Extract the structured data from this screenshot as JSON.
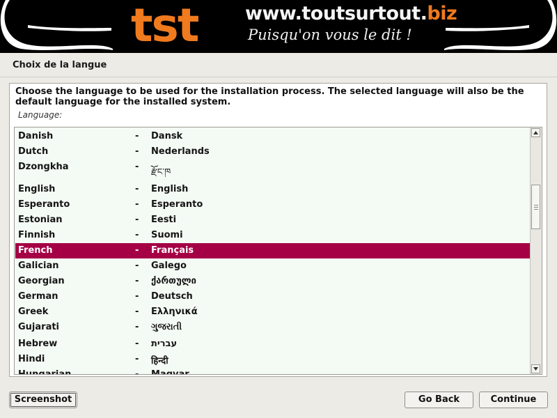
{
  "banner": {
    "logo_text": "tst",
    "site_main": "www.toutsurtout.",
    "site_tld": "biz",
    "slogan": "Puisqu'on vous le dit !"
  },
  "heading": "Choix de la langue",
  "instruction": "Choose the language to be used for the installation process. The selected language will also be the default language for the installed system.",
  "language_label": "Language:",
  "languages": [
    {
      "name": "Danish",
      "native": "Dansk"
    },
    {
      "name": "Dutch",
      "native": "Nederlands"
    },
    {
      "name": "Dzongkha",
      "native": "རྫོང་ཁ"
    },
    {
      "name": "English",
      "native": "English"
    },
    {
      "name": "Esperanto",
      "native": "Esperanto"
    },
    {
      "name": "Estonian",
      "native": "Eesti"
    },
    {
      "name": "Finnish",
      "native": "Suomi"
    },
    {
      "name": "French",
      "native": "Français"
    },
    {
      "name": "Galician",
      "native": "Galego"
    },
    {
      "name": "Georgian",
      "native": "ქართული"
    },
    {
      "name": "German",
      "native": "Deutsch"
    },
    {
      "name": "Greek",
      "native": "Ελληνικά"
    },
    {
      "name": "Gujarati",
      "native": "ગુજરાતી"
    },
    {
      "name": "Hebrew",
      "native": "עברית"
    },
    {
      "name": "Hindi",
      "native": "हिन्दी"
    },
    {
      "name": "Hungarian",
      "native": "Magyar"
    }
  ],
  "separator": "-",
  "selected_language": "French",
  "buttons": {
    "screenshot": "Screenshot",
    "go_back": "Go Back",
    "continue": "Continue"
  },
  "colors": {
    "selection": "#a50045",
    "logo_orange": "#f07a1e",
    "list_background": "#f4faf4"
  }
}
